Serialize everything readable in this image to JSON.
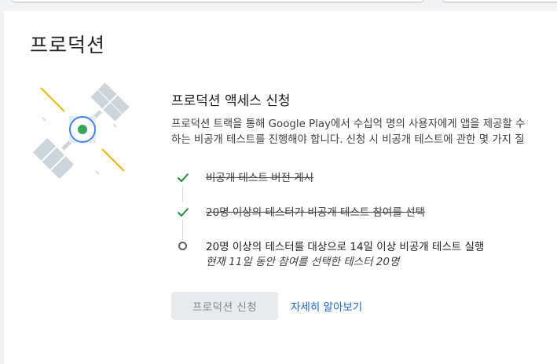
{
  "page": {
    "section_title": "프로덕션"
  },
  "card": {
    "title": "프로덕션 액세스 신청",
    "description_lines": [
      "프로덕션 트랙을 통해 Google Play에서 수십억 명의 사용자에게 앱을 제공할 수",
      "하는 비공개 테스트를 진행해야 합니다. 신청 시 비공개 테스트에 관한 몇 가지 질"
    ],
    "steps": [
      {
        "label": "비공개 테스트 버전 게시",
        "status": "completed",
        "icon": "check-icon"
      },
      {
        "label": "20명 이상의 테스터가 비공개 테스트 참여를 선택",
        "status": "completed",
        "icon": "check-icon"
      },
      {
        "label": "20명 이상의 테스터를 대상으로 14일 이상 비공개 테스트 실행",
        "status": "pending",
        "icon": "circle-icon",
        "detail": "현재 11일 동안 참여를 선택한 테스터 20명"
      }
    ],
    "apply_button_label": "프로덕션 신청",
    "learn_more_label": "자세히 알아보기"
  },
  "colors": {
    "check": "#1e8e3e",
    "link": "#1967d2",
    "disabled_button_bg": "#e8eaed",
    "satellite_panel": "#cdd5dc",
    "satellite_ring": "#4285f4",
    "satellite_core": "#34a853",
    "satellite_beam": "#f4b400"
  }
}
